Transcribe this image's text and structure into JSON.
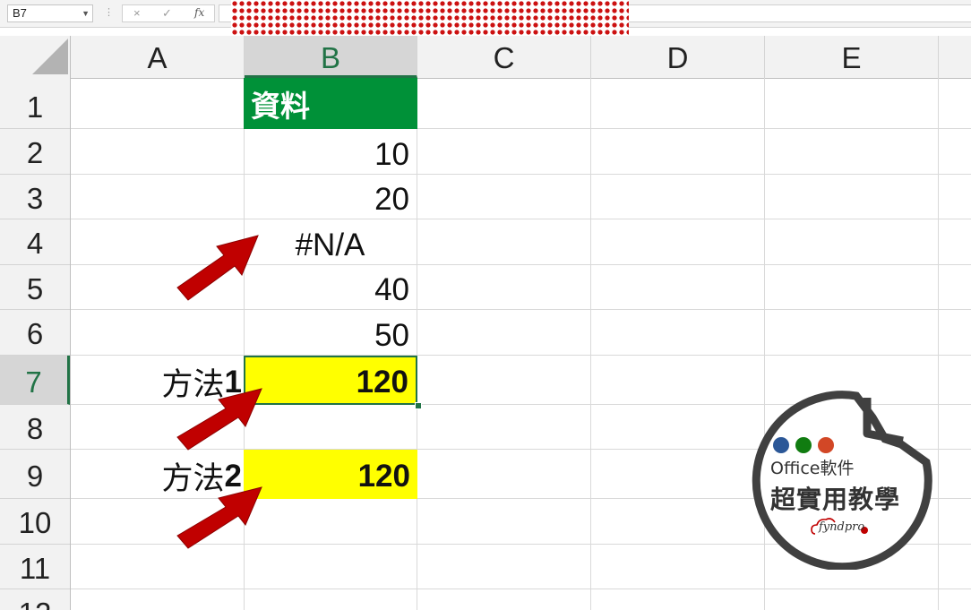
{
  "formula_bar": {
    "name_box": "B7",
    "cancel_icon": "×",
    "enter_icon": "✓",
    "function_label": "fx",
    "formula": ""
  },
  "columns": [
    "A",
    "B",
    "C",
    "D",
    "E"
  ],
  "selected_column": "B",
  "rows": [
    "1",
    "2",
    "3",
    "4",
    "5",
    "6",
    "7",
    "8",
    "9",
    "10",
    "11",
    "12"
  ],
  "selected_row": "7",
  "cells": {
    "B1": "資料",
    "B2": "10",
    "B3": "20",
    "B4": "#N/A",
    "B5": "40",
    "B6": "50",
    "A7_text": "方法",
    "A7_num": "1",
    "B7": "120",
    "A9_text": "方法",
    "A9_num": "2",
    "B9": "120"
  },
  "colors": {
    "header_fill": "#009138",
    "highlight_fill": "#ffff00",
    "selection_border": "#217346",
    "arrow": "#c00000",
    "redaction": "#cc1111"
  },
  "logo": {
    "line1": "Office軟件",
    "line2": "超實用教學",
    "brand": "fyndpro",
    "dot_colors": [
      "#2b5797",
      "#107c10",
      "#d24726"
    ]
  }
}
